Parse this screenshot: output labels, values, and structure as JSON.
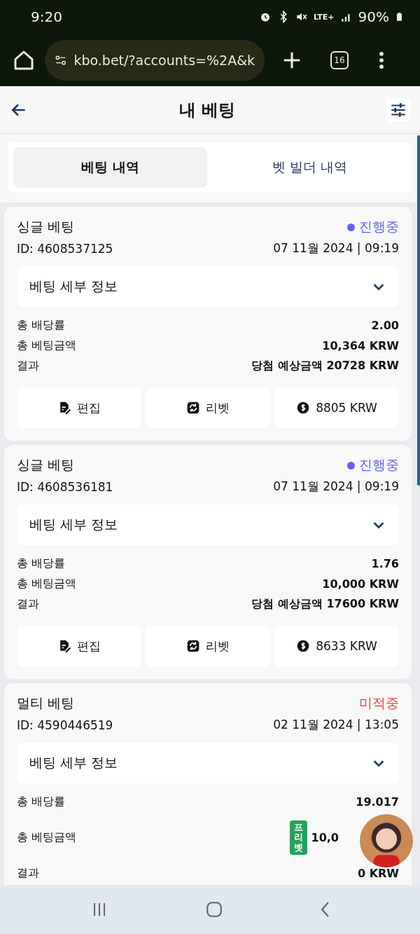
{
  "status_bar": {
    "time": "9:20",
    "network": "LTE+",
    "battery": "90%"
  },
  "browser": {
    "url": "kbo.bet/?accounts=%2A&k",
    "tab_count": "16"
  },
  "header": {
    "title": "내 베팅"
  },
  "tabs": [
    {
      "label": "베팅 내역",
      "selected": true
    },
    {
      "label": "벳 빌더 내역",
      "selected": false
    }
  ],
  "bets": [
    {
      "type": "싱글 베팅",
      "status": {
        "label": "진행중",
        "color": "#6464f0",
        "dot": true
      },
      "id": "ID: 4608537125",
      "date": "07 11월 2024 | 09:19",
      "details": "베팅 세부 정보",
      "rows": [
        {
          "label": "총 배당률",
          "value": "2.00"
        },
        {
          "label": "총 베팅금액",
          "value": "10,364 KRW"
        },
        {
          "label": "결과",
          "value": "당첨 예상금액 20728 KRW"
        }
      ],
      "actions": [
        {
          "kind": "edit",
          "label": "편집"
        },
        {
          "kind": "rebet",
          "label": "리벳"
        },
        {
          "kind": "cashout",
          "label": "8805 KRW"
        }
      ]
    },
    {
      "type": "싱글 베팅",
      "status": {
        "label": "진행중",
        "color": "#6464f0",
        "dot": true
      },
      "id": "ID: 4608536181",
      "date": "07 11월 2024 | 09:19",
      "details": "베팅 세부 정보",
      "rows": [
        {
          "label": "총 배당률",
          "value": "1.76"
        },
        {
          "label": "총 베팅금액",
          "value": "10,000 KRW"
        },
        {
          "label": "결과",
          "value": "당첨 예상금액 17600 KRW"
        }
      ],
      "actions": [
        {
          "kind": "edit",
          "label": "편집"
        },
        {
          "kind": "rebet",
          "label": "리벳"
        },
        {
          "kind": "cashout",
          "label": "8633 KRW"
        }
      ]
    },
    {
      "type": "멀티 베팅",
      "status": {
        "label": "미적중",
        "color": "#e5484d",
        "dot": false
      },
      "id": "ID: 4590446519",
      "date": "02 11월 2024 | 13:05",
      "details": "베팅 세부 정보",
      "rows": [
        {
          "label": "총 배당률",
          "value": "19.017"
        },
        {
          "label": "총 베팅금액",
          "value": "10,0",
          "badge": "프리벳"
        },
        {
          "label": "결과",
          "value": "0 KRW"
        }
      ]
    }
  ]
}
